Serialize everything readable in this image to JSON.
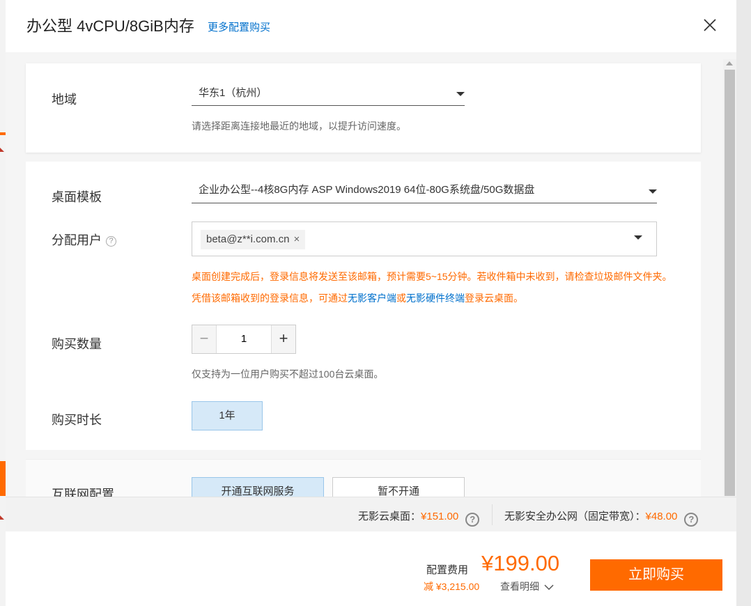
{
  "dialog": {
    "title": "办公型 4vCPU/8GiB内存",
    "more_link": "更多配置购买"
  },
  "region": {
    "label": "地域",
    "value": "华东1（杭州）",
    "hint": "请选择距离连接地最近的地域，以提升访问速度。"
  },
  "template": {
    "label": "桌面模板",
    "value": "企业办公型--4核8G内存 ASP Windows2019 64位-80G系统盘/50G数据盘"
  },
  "assign_user": {
    "label": "分配用户",
    "help_icon": "?",
    "user_tag": "beta@z**i.com.cn",
    "remove_icon": "×",
    "warning_part1": "桌面创建完成后，登录信息将发送至该邮箱，预计需要5~15分钟。若收件箱中未收到，请检查垃圾邮件文件夹。凭借该邮箱收到的登录信息，可通过",
    "link_client": "无影客户端",
    "warning_or": "或",
    "link_hardware": "无影硬件终端",
    "warning_part2": "登录云桌面。"
  },
  "quantity": {
    "label": "购买数量",
    "value": "1",
    "minus": "−",
    "plus": "+",
    "hint": "仅支持为一位用户购买不超过100台云桌面。"
  },
  "duration": {
    "label": "购买时长",
    "option": "1年"
  },
  "internet": {
    "label": "互联网配置",
    "option_enable": "开通互联网服务",
    "option_disable": "暂不开通"
  },
  "price_bar": {
    "desktop_label": "无影云桌面：",
    "desktop_value": "¥151.00",
    "network_label": "无影安全办公网（固定带宽）：",
    "network_value": "¥48.00",
    "help_icon": "?"
  },
  "footer": {
    "fee_label": "配置费用",
    "fee_value": "¥199.00",
    "discount": "减 ¥3,215.00",
    "detail": "查看明细",
    "buy": "立即购买"
  },
  "colors": {
    "accent": "#ff6a00",
    "link": "#0070cc",
    "selected_option": "#d6e9f8"
  }
}
